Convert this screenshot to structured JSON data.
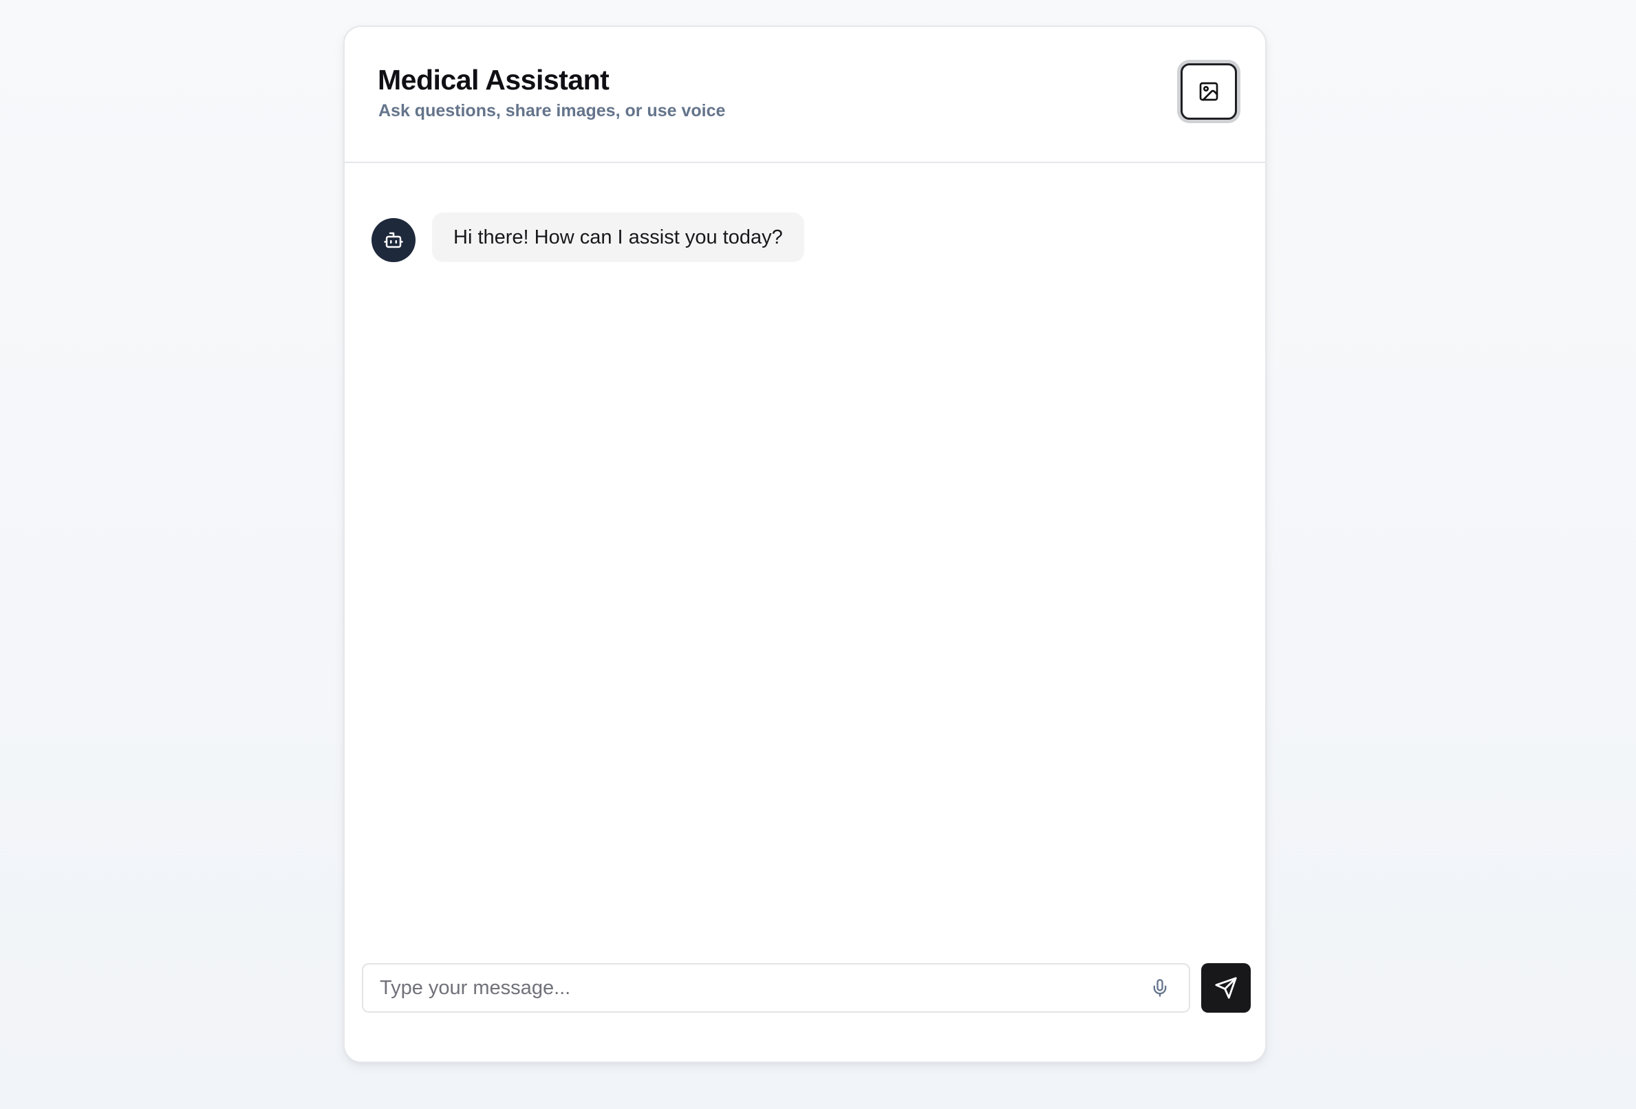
{
  "header": {
    "title": "Medical Assistant",
    "subtitle": "Ask questions, share images, or use voice",
    "upload_icon": "image-icon"
  },
  "messages": [
    {
      "role": "assistant",
      "avatar_icon": "bot-icon",
      "text": "Hi there! How can I assist you today?"
    }
  ],
  "composer": {
    "placeholder": "Type your message...",
    "value": "",
    "mic_icon": "microphone-icon",
    "send_icon": "send-icon"
  },
  "colors": {
    "accent_dark": "#18181b",
    "avatar_bg": "#1e293b",
    "subtitle_text": "#64748b",
    "bubble_bg": "#f4f4f5"
  }
}
